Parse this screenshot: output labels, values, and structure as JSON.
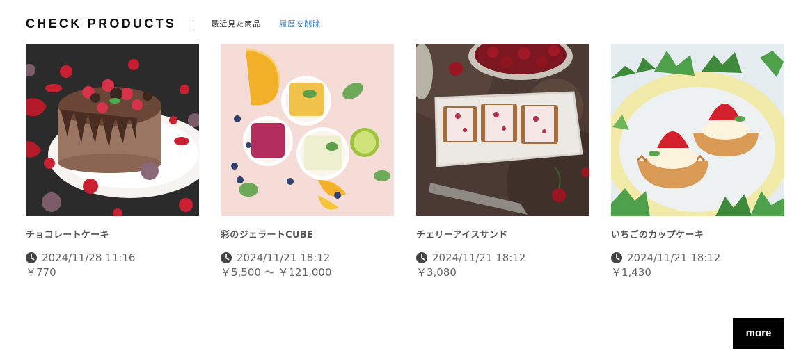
{
  "header": {
    "title": "CHECK PRODUCTS",
    "subtitle": "最近見た商品",
    "clear_history": "履歴を削除"
  },
  "products": [
    {
      "name": "チョコレートケーキ",
      "viewed_at": "2024/11/28 11:16",
      "price": "￥770",
      "image": "chocolate-cake-photo"
    },
    {
      "name": "彩のジェラートCUBE",
      "viewed_at": "2024/11/21 18:12",
      "price": "￥5,500 ～ ￥121,000",
      "image": "gelato-cube-photo"
    },
    {
      "name": "チェリーアイスサンド",
      "viewed_at": "2024/11/21 18:12",
      "price": "￥3,080",
      "image": "cherry-ice-sandwich-photo"
    },
    {
      "name": "いちごのカップケーキ",
      "viewed_at": "2024/11/21 18:12",
      "price": "￥1,430",
      "image": "strawberry-cupcake-photo"
    }
  ],
  "more_button": "more",
  "colors": {
    "link": "#3f7fb6",
    "button_bg": "#000000",
    "button_text": "#ffffff",
    "meta_text": "#666666"
  },
  "icons": {
    "timestamp": "clock-icon"
  }
}
